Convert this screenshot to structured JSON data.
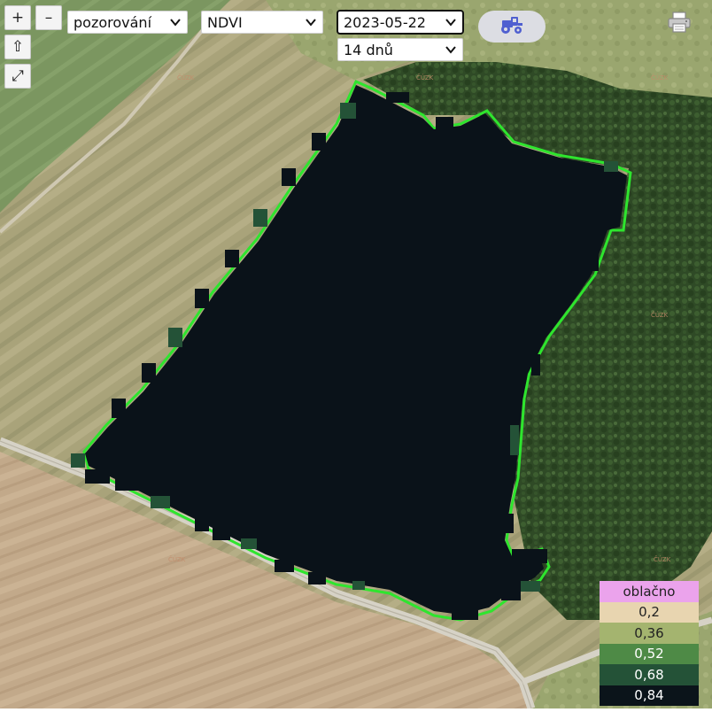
{
  "controls": {
    "zoom_in_label": "+",
    "zoom_out_label": "–",
    "home_label": "⇧",
    "fullscreen_label": "⤢"
  },
  "selects": {
    "mode": {
      "value": "pozorování"
    },
    "index": {
      "value": "NDVI"
    },
    "date": {
      "value": "2023-05-22"
    },
    "period": {
      "value": "14 dnů"
    }
  },
  "toolbar": {
    "tractor_icon": "tractor-icon",
    "print_icon": "printer-icon",
    "accent_color": "#4f5fd0"
  },
  "map": {
    "field_outline_color": "#2ee52e",
    "field_fill_color": "#0a1219",
    "field_labels": [
      "ČÚZK",
      "ČÚZK",
      "ČÚZK",
      "ČÚZK",
      "ČÚZK",
      "ČÚZK"
    ]
  },
  "legend": {
    "rows": [
      {
        "label": "oblačno",
        "color": "#eba3ec",
        "text_color": "#222222"
      },
      {
        "label": "0,2",
        "color": "#e8d5b0",
        "text_color": "#222222"
      },
      {
        "label": "0,36",
        "color": "#a4b46f",
        "text_color": "#222222"
      },
      {
        "label": "0,52",
        "color": "#4e8a46",
        "text_color": "#ffffff"
      },
      {
        "label": "0,68",
        "color": "#245237",
        "text_color": "#ffffff"
      },
      {
        "label": "0,84",
        "color": "#0b141a",
        "text_color": "#ffffff"
      }
    ]
  }
}
